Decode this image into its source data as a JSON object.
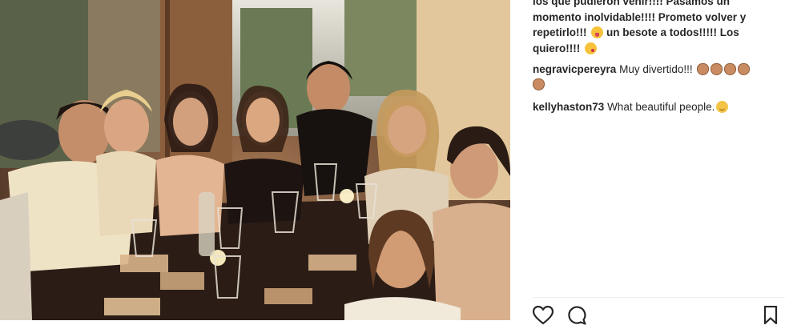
{
  "post": {
    "caption_lines": [
      "los que pudieron venir!!!! Pasamos un",
      "momento inolvidable!!!! Prometo volver y",
      "repetirlo!!! ",
      " un besote a todos!!!!! Los",
      "quiero!!!! "
    ],
    "caption_emojis": [
      "tongue-emoji",
      "wink-emoji"
    ],
    "comments": [
      {
        "username": "negravicpereyra",
        "text": "Muy divertido!!!",
        "emojis": [
          "clapping-hands-emoji",
          "clapping-hands-emoji",
          "clapping-hands-emoji",
          "clapping-hands-emoji",
          "clapping-hands-emoji"
        ]
      },
      {
        "username": "kellyhaston73",
        "text": "What beautiful people.",
        "emojis": [
          "smile-emoji"
        ]
      }
    ]
  },
  "actions": {
    "like_icon": "heart-icon",
    "comment_icon": "comment-icon",
    "save_icon": "bookmark-icon"
  },
  "colors": {
    "text": "#262626",
    "divider": "#efefef",
    "icon": "#262626"
  }
}
